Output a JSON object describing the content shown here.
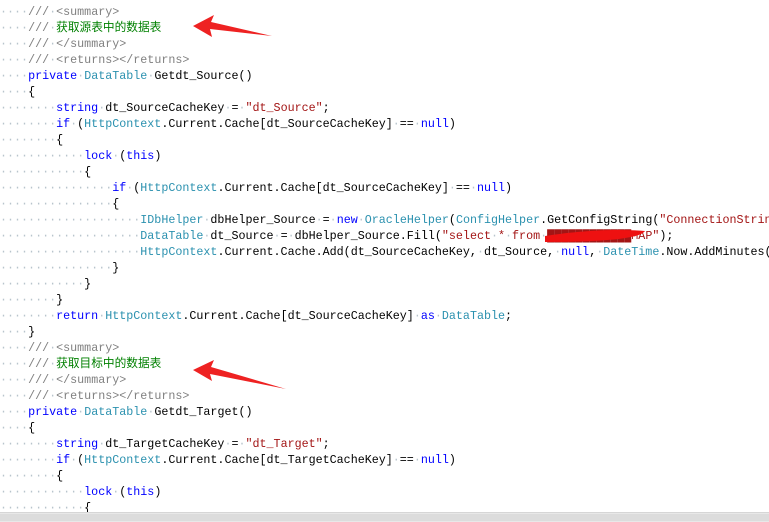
{
  "colors": {
    "keyword": "#0000ff",
    "type": "#2b91af",
    "string": "#a31515",
    "comment": "#008000",
    "doc_tag": "#808080",
    "annotation_arrow": "#ee2222",
    "redaction": "#ee1111"
  },
  "lines": [
    {
      "indent": 4,
      "tokens": [
        [
          "doc",
          "/// <summary>"
        ]
      ]
    },
    {
      "indent": 4,
      "tokens": [
        [
          "doc",
          "/// "
        ],
        [
          "cm",
          "获取源表中的数据表"
        ]
      ]
    },
    {
      "indent": 4,
      "tokens": [
        [
          "doc",
          "/// </summary>"
        ]
      ]
    },
    {
      "indent": 4,
      "tokens": [
        [
          "doc",
          "/// <returns></returns>"
        ]
      ]
    },
    {
      "indent": 4,
      "tokens": [
        [
          "kw",
          "private"
        ],
        [
          "plain",
          " "
        ],
        [
          "type",
          "DataTable"
        ],
        [
          "plain",
          " Getdt_Source()"
        ]
      ]
    },
    {
      "indent": 4,
      "tokens": [
        [
          "plain",
          "{"
        ]
      ]
    },
    {
      "indent": 8,
      "tokens": [
        [
          "kw",
          "string"
        ],
        [
          "plain",
          " dt_SourceCacheKey = "
        ],
        [
          "str",
          "\"dt_Source\""
        ],
        [
          "plain",
          ";"
        ]
      ]
    },
    {
      "indent": 8,
      "tokens": [
        [
          "kw",
          "if"
        ],
        [
          "plain",
          " ("
        ],
        [
          "type",
          "HttpContext"
        ],
        [
          "plain",
          ".Current.Cache[dt_SourceCacheKey] == "
        ],
        [
          "kw",
          "null"
        ],
        [
          "plain",
          ")"
        ]
      ]
    },
    {
      "indent": 8,
      "tokens": [
        [
          "plain",
          "{"
        ]
      ]
    },
    {
      "indent": 12,
      "tokens": [
        [
          "kw",
          "lock"
        ],
        [
          "plain",
          " ("
        ],
        [
          "kw",
          "this"
        ],
        [
          "plain",
          ")"
        ]
      ]
    },
    {
      "indent": 12,
      "tokens": [
        [
          "plain",
          "{"
        ]
      ]
    },
    {
      "indent": 16,
      "tokens": [
        [
          "kw",
          "if"
        ],
        [
          "plain",
          " ("
        ],
        [
          "type",
          "HttpContext"
        ],
        [
          "plain",
          ".Current.Cache[dt_SourceCacheKey] == "
        ],
        [
          "kw",
          "null"
        ],
        [
          "plain",
          ")"
        ]
      ]
    },
    {
      "indent": 16,
      "tokens": [
        [
          "plain",
          "{"
        ]
      ]
    },
    {
      "indent": 20,
      "tokens": [
        [
          "type",
          "IDbHelper"
        ],
        [
          "plain",
          " dbHelper_Source = "
        ],
        [
          "kw",
          "new"
        ],
        [
          "plain",
          " "
        ],
        [
          "type",
          "OracleHelper"
        ],
        [
          "plain",
          "("
        ],
        [
          "type",
          "ConfigHelper"
        ],
        [
          "plain",
          ".GetConfigString("
        ],
        [
          "str",
          "\"ConnectionStrin"
        ]
      ]
    },
    {
      "indent": 20,
      "tokens": [
        [
          "type",
          "DataTable"
        ],
        [
          "plain",
          " dt_Source = dbHelper_Source.Fill("
        ],
        [
          "str",
          "\"select * from ████████████MAP\""
        ],
        [
          "plain",
          ");"
        ]
      ]
    },
    {
      "indent": 20,
      "tokens": [
        [
          "type",
          "HttpContext"
        ],
        [
          "plain",
          ".Current.Cache.Add(dt_SourceCacheKey, dt_Source, "
        ],
        [
          "kw",
          "null"
        ],
        [
          "plain",
          ", "
        ],
        [
          "type",
          "DateTime"
        ],
        [
          "plain",
          ".Now.AddMinutes("
        ]
      ]
    },
    {
      "indent": 16,
      "tokens": [
        [
          "plain",
          "}"
        ]
      ]
    },
    {
      "indent": 12,
      "tokens": [
        [
          "plain",
          "}"
        ]
      ]
    },
    {
      "indent": 8,
      "tokens": [
        [
          "plain",
          "}"
        ]
      ]
    },
    {
      "indent": 8,
      "tokens": [
        [
          "kw",
          "return"
        ],
        [
          "plain",
          " "
        ],
        [
          "type",
          "HttpContext"
        ],
        [
          "plain",
          ".Current.Cache[dt_SourceCacheKey] "
        ],
        [
          "kw",
          "as"
        ],
        [
          "plain",
          " "
        ],
        [
          "type",
          "DataTable"
        ],
        [
          "plain",
          ";"
        ]
      ]
    },
    {
      "indent": 4,
      "tokens": [
        [
          "plain",
          "}"
        ]
      ]
    },
    {
      "indent": 4,
      "tokens": [
        [
          "doc",
          "/// <summary>"
        ]
      ]
    },
    {
      "indent": 4,
      "tokens": [
        [
          "doc",
          "/// "
        ],
        [
          "cm",
          "获取目标中的数据表"
        ]
      ]
    },
    {
      "indent": 4,
      "tokens": [
        [
          "doc",
          "/// </summary>"
        ]
      ]
    },
    {
      "indent": 4,
      "tokens": [
        [
          "doc",
          "/// <returns></returns>"
        ]
      ]
    },
    {
      "indent": 4,
      "tokens": [
        [
          "kw",
          "private"
        ],
        [
          "plain",
          " "
        ],
        [
          "type",
          "DataTable"
        ],
        [
          "plain",
          " Getdt_Target()"
        ]
      ]
    },
    {
      "indent": 4,
      "tokens": [
        [
          "plain",
          "{"
        ]
      ]
    },
    {
      "indent": 8,
      "tokens": [
        [
          "kw",
          "string"
        ],
        [
          "plain",
          " dt_TargetCacheKey = "
        ],
        [
          "str",
          "\"dt_Target\""
        ],
        [
          "plain",
          ";"
        ]
      ]
    },
    {
      "indent": 8,
      "tokens": [
        [
          "kw",
          "if"
        ],
        [
          "plain",
          " ("
        ],
        [
          "type",
          "HttpContext"
        ],
        [
          "plain",
          ".Current.Cache[dt_TargetCacheKey] == "
        ],
        [
          "kw",
          "null"
        ],
        [
          "plain",
          ")"
        ]
      ]
    },
    {
      "indent": 8,
      "tokens": [
        [
          "plain",
          "{"
        ]
      ]
    },
    {
      "indent": 12,
      "tokens": [
        [
          "kw",
          "lock"
        ],
        [
          "plain",
          " ("
        ],
        [
          "kw",
          "this"
        ],
        [
          "plain",
          ")"
        ]
      ]
    },
    {
      "indent": 12,
      "tokens": [
        [
          "plain",
          "{"
        ]
      ]
    }
  ]
}
